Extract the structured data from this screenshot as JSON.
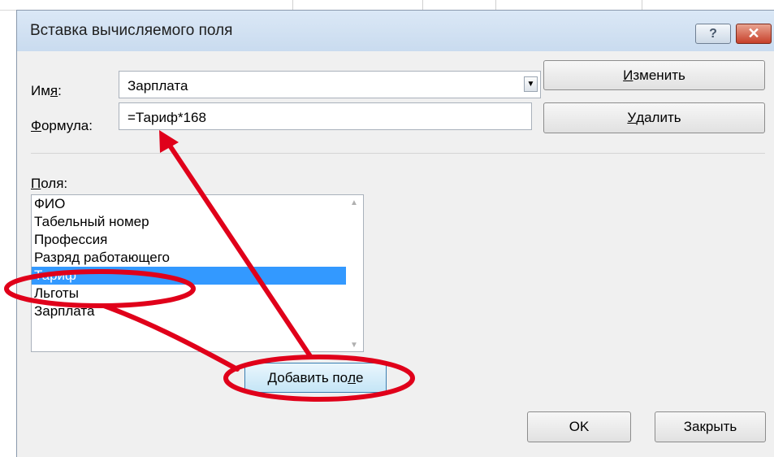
{
  "dialog": {
    "title": "Вставка вычисляемого поля",
    "help_glyph": "?",
    "close_glyph": "✕"
  },
  "form": {
    "name_label_pre": "Им",
    "name_label_ul": "я",
    "name_label_post": ":",
    "name_value": "Зарплата",
    "formula_label_ul": "Ф",
    "formula_label_post": "ормула:",
    "formula_value": "=Тариф*168"
  },
  "buttons": {
    "modify_ul": "И",
    "modify_rest": "зменить",
    "delete_ul": "У",
    "delete_rest": "далить",
    "add_field_pre": "Добавить по",
    "add_field_ul": "л",
    "add_field_post": "е",
    "ok": "OK",
    "close": "Закрыть"
  },
  "fields": {
    "label_ul": "П",
    "label_rest": "оля:",
    "items": [
      "ФИО",
      "Табельный номер",
      "Профессия",
      "Разряд работающего",
      "Тариф",
      "Льготы",
      "Зарплата"
    ],
    "selected_index": 4
  },
  "colors": {
    "selection": "#3399ff",
    "annotation": "#e0001a"
  }
}
